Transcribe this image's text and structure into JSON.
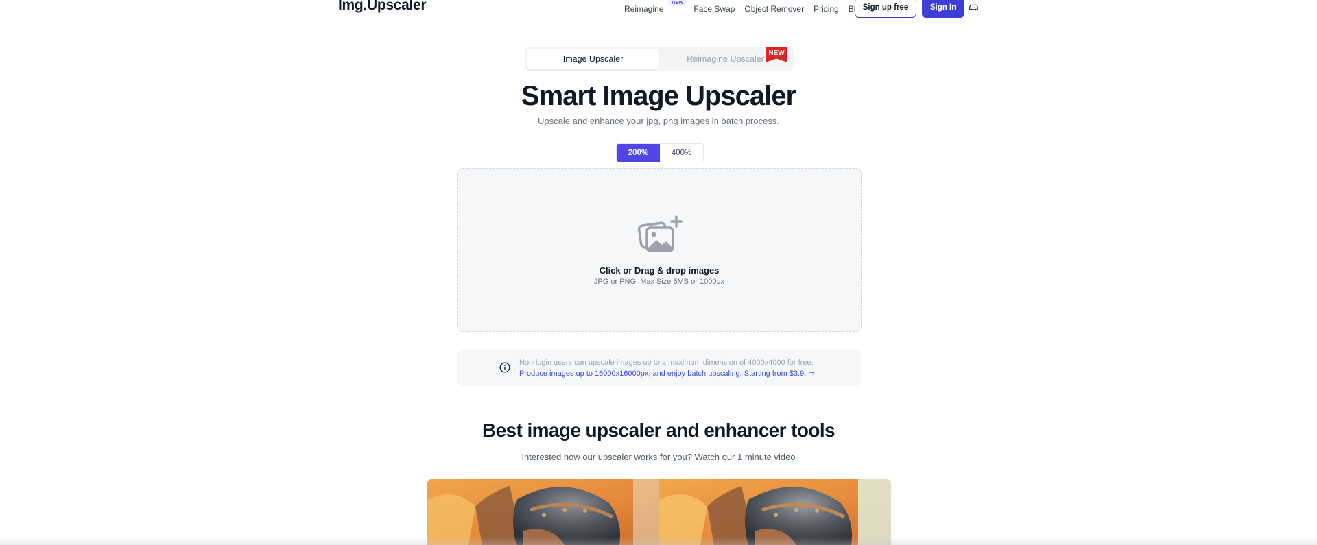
{
  "header": {
    "logo": "Img.Upscaler",
    "nav": {
      "reimagine": "Reimagine",
      "reimagine_badge": "new",
      "face_swap": "Face Swap",
      "object_remover": "Object Remover",
      "pricing": "Pricing",
      "blog": "Blog"
    },
    "signup_label": "Sign up free",
    "signin_label": "Sign In",
    "discord_icon": "discord-icon"
  },
  "mode_tabs": {
    "image_upscaler": "Image Upscaler",
    "reimagine_upscaler": "Reimagine Upscaler",
    "new_ribbon": "NEW"
  },
  "hero": {
    "title": "Smart Image Upscaler",
    "subtitle": "Upscale and enhance your jpg, png images in batch process."
  },
  "scale": {
    "options": [
      "200%",
      "400%"
    ],
    "selected": "200%"
  },
  "dropzone": {
    "icon": "add-image-icon",
    "title": "Click or Drag & drop images",
    "subtitle": "JPG or PNG. Max Size 5MB or 1000px"
  },
  "info": {
    "icon": "info-icon",
    "line1": "Non-login users can upscale images up to a maximum dimension of 4000x4000 for free.",
    "line2": "Produce images up to 16000x16000px, and enjoy batch upscaling. Starting from $3.9. ⇒"
  },
  "tools_section": {
    "title": "Best image upscaler and enhancer tools",
    "subtitle": "Interested how our upscaler works for you? Watch our 1 minute video"
  },
  "colors": {
    "accent": "#4f46e5",
    "signin_bg": "#3b3fd8",
    "ribbon": "#dc2626",
    "link": "#3b4ecf"
  }
}
